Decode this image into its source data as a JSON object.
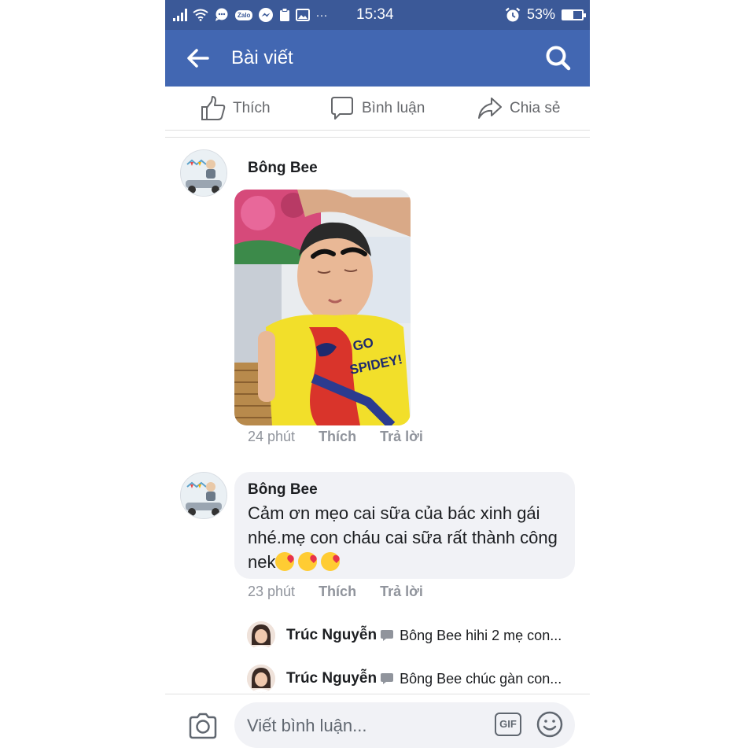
{
  "status_bar": {
    "time": "15:34",
    "battery": "53%",
    "battery_level": 0.53,
    "zalo": "Zalo",
    "more": "···"
  },
  "header": {
    "title": "Bài viết"
  },
  "actions": {
    "like": "Thích",
    "comment": "Bình luận",
    "share": "Chia sẻ"
  },
  "comments": [
    {
      "author": "Bông Bee",
      "time": "24 phút",
      "like": "Thích",
      "reply": "Trả lời",
      "attachment": "photo"
    },
    {
      "author": "Bông Bee",
      "text": "Cảm ơn mẹo cai sữa của bác xinh gái nhé.mẹ con cháu cai sữa rất thành công  nek",
      "time": "23 phút",
      "like": "Thích",
      "reply": "Trả lời",
      "replies": [
        {
          "author": "Trúc Nguyễn",
          "preview": "Bông Bee hihi 2 mẹ con..."
        },
        {
          "author": "Trúc Nguyễn",
          "preview": "Bông Bee chúc gàn con..."
        }
      ]
    }
  ],
  "composer": {
    "placeholder": "Viết bình luận...",
    "gif": "GIF"
  },
  "colors": {
    "header": "#4267b2",
    "status_bar": "#3b5998",
    "secondary_text": "#90949c",
    "bubble": "#f1f2f6"
  }
}
